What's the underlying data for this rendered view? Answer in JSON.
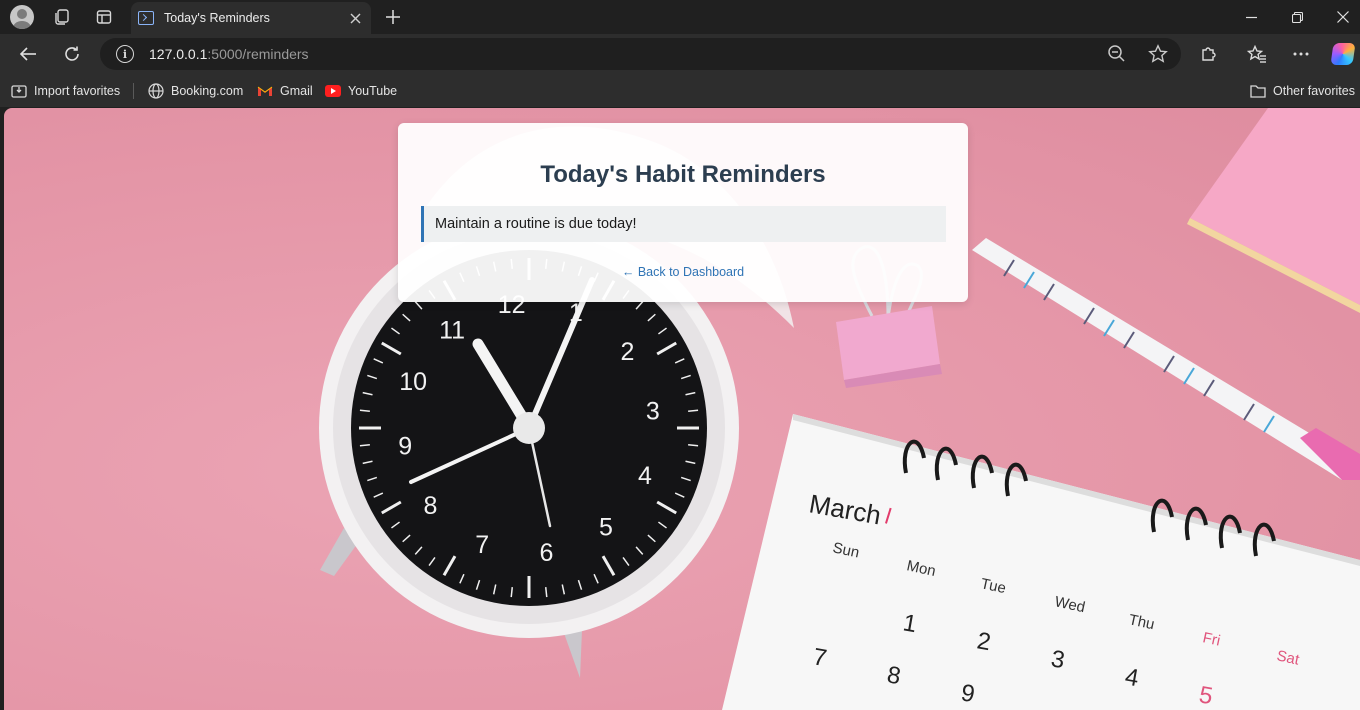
{
  "browser": {
    "tab_title": "Today's Reminders",
    "url_host": "127.0.0.1",
    "url_rest": ":5000/reminders",
    "icons": {
      "profile": "profile-avatar-icon",
      "workspaces": "workspaces-icon",
      "tab_actions": "vertical-tabs-icon",
      "favicon": "terminal-favicon-icon",
      "close": "close-icon",
      "new_tab": "plus-icon",
      "back": "arrow-left-icon",
      "reload": "reload-icon",
      "site_info": "info-icon",
      "zoom": "zoom-out-icon",
      "favorite": "star-icon",
      "extensions": "puzzle-icon",
      "favorites": "favorites-star-icon",
      "more": "more-dots-icon",
      "copilot": "copilot-icon"
    }
  },
  "favorites_bar": {
    "items": [
      {
        "label": "Import favorites",
        "icon": "import-icon"
      },
      {
        "label": "Booking.com",
        "icon": "globe-icon"
      },
      {
        "label": "Gmail",
        "icon": "gmail-icon"
      },
      {
        "label": "YouTube",
        "icon": "youtube-icon"
      }
    ],
    "other": {
      "label": "Other favorites",
      "icon": "folder-icon"
    }
  },
  "page": {
    "heading": "Today's Habit Reminders",
    "reminders": [
      {
        "text": "Maintain a routine is due today!"
      }
    ],
    "back_link": "← Back to Dashboard",
    "colors": {
      "heading": "#2c3e50",
      "accent": "#2f74b5",
      "reminder_bg": "#eef0f1"
    }
  },
  "background_photo": {
    "calendar_month": "March",
    "weekdays": [
      "Sun",
      "Mon",
      "Tue",
      "Wed",
      "Thu",
      "Fri",
      "Sat"
    ],
    "dates_row1": [
      "1",
      "2",
      "3",
      "4",
      "5"
    ],
    "dates_row2": [
      "7",
      "8",
      "9"
    ],
    "clock_numbers": [
      "12",
      "1",
      "2",
      "3",
      "4",
      "5",
      "6",
      "7",
      "8",
      "9",
      "10",
      "11"
    ]
  }
}
